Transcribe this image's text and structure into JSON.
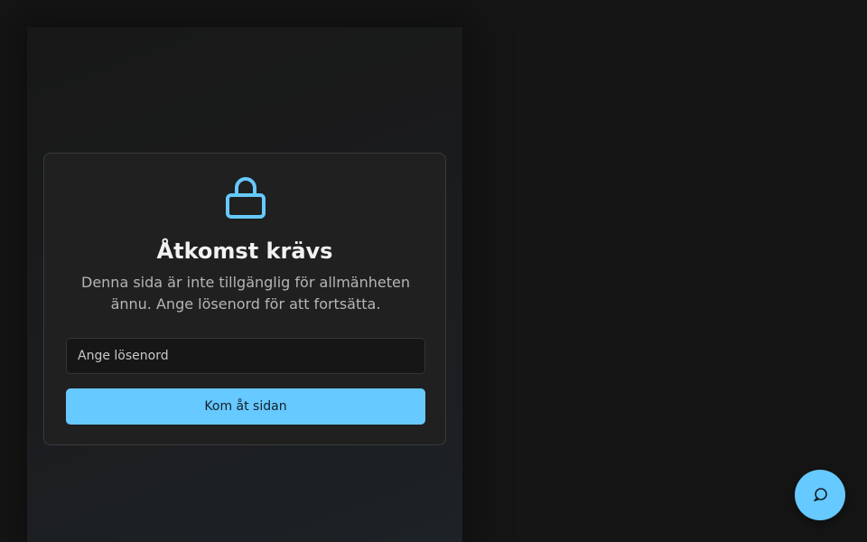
{
  "gate": {
    "icon": "lock-icon",
    "title": "Åtkomst krävs",
    "description": "Denna sida är inte tillgänglig för allmänheten ännu. Ange lösenord för att fortsätta.",
    "password_placeholder": "Ange lösenord",
    "submit_label": "Kom åt sidan"
  },
  "chat": {
    "icon": "chat-bubble-icon"
  },
  "colors": {
    "accent": "#66c9ff",
    "background": "#151515",
    "card": "#202020"
  }
}
